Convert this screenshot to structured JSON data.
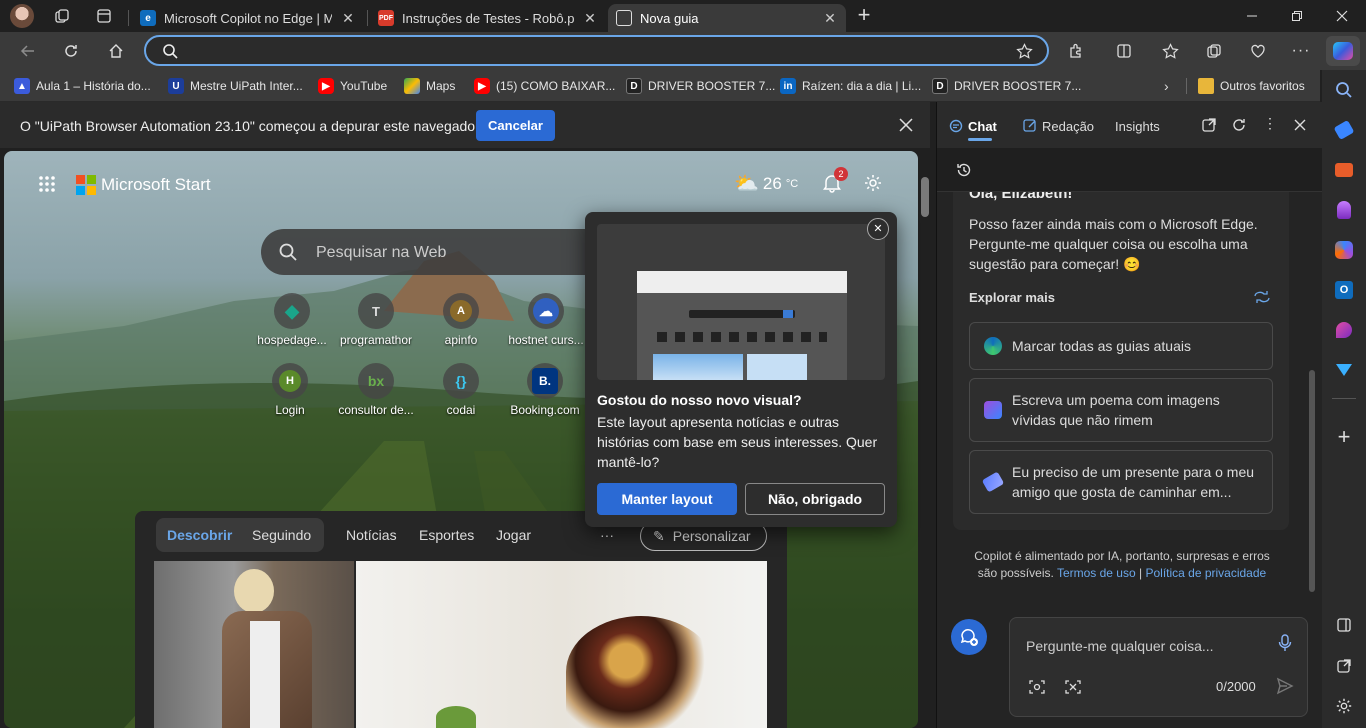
{
  "tabs": [
    {
      "title": "Microsoft Copilot no Edge | Micr",
      "close": "✕"
    },
    {
      "title": "Instruções de Testes - Robô.pdf",
      "close": "✕"
    },
    {
      "title": "Nova guia",
      "close": "✕"
    }
  ],
  "new_tab_symbol": "+",
  "address": {
    "value": "",
    "placeholder": ""
  },
  "bookmarks": [
    {
      "label": "Aula 1 – História do...",
      "icon": "course-icon",
      "color": "#3b5bdb"
    },
    {
      "label": "Mestre UiPath Inter...",
      "icon": "uipath-icon",
      "color": "#1c3d9a"
    },
    {
      "label": "YouTube",
      "icon": "youtube-icon",
      "color": "#ff0000"
    },
    {
      "label": "Maps",
      "icon": "maps-icon",
      "color": "#34a853"
    },
    {
      "label": "(15) COMO BAIXAR...",
      "icon": "youtube-icon",
      "color": "#ff0000"
    },
    {
      "label": "DRIVER BOOSTER 7...",
      "icon": "driver-booster-icon",
      "color": "#222222"
    },
    {
      "label": "Raízen: dia a dia | Li...",
      "icon": "linkedin-icon",
      "color": "#0a66c2"
    },
    {
      "label": "DRIVER BOOSTER 7...",
      "icon": "driver-booster-icon",
      "color": "#222222"
    }
  ],
  "other_favorites": "Outros favoritos",
  "infobar": {
    "message": "O \"UiPath Browser Automation 23.10\" começou a depurar este navegador",
    "cancel": "Cancelar"
  },
  "start": {
    "brand": "Microsoft Start",
    "temperature": "26",
    "temp_unit": "°C",
    "notif_count": "2",
    "search_placeholder": "Pesquisar na Web",
    "shortcuts": [
      {
        "label": "hospedage...",
        "glyph": "◆",
        "color": "#1aa58a"
      },
      {
        "label": "programathor",
        "glyph": "T",
        "color": "#555555"
      },
      {
        "label": "apinfo",
        "glyph": "A",
        "color": "#8a6a2a"
      },
      {
        "label": "hostnet curs...",
        "glyph": "☁",
        "color": "#3060c0"
      },
      {
        "label": "Login",
        "glyph": "H",
        "color": "#5a8a2a"
      },
      {
        "label": "consultor de...",
        "glyph": "bx",
        "color": "#3a6a3a"
      },
      {
        "label": "codai",
        "glyph": "{}",
        "color": "#3a3a3a"
      },
      {
        "label": "Booking.com",
        "glyph": "B.",
        "color": "#003580"
      }
    ],
    "feed_tabs": [
      "Descobrir",
      "Seguindo",
      "Notícias",
      "Esportes",
      "Jogar"
    ],
    "more": "···",
    "personalize": "Personalizar"
  },
  "popup": {
    "title": "Gostou do nosso novo visual?",
    "body": "Este layout apresenta notícias e outras histórias com base em seus interesses. Quer mantê-lo?",
    "primary": "Manter layout",
    "secondary": "Não, obrigado",
    "close": "✕"
  },
  "copilot": {
    "tabs": [
      "Chat",
      "Redação",
      "Insights"
    ],
    "greeting": "Olá, Elizabeth!",
    "intro": "Posso fazer ainda mais com o Microsoft Edge. Pergunte-me qualquer coisa ou escolha uma sugestão para começar! 😊",
    "explore": "Explorar mais",
    "suggestions": [
      {
        "text": "Marcar todas as guias atuais",
        "icon": "edge-icon"
      },
      {
        "text": "Escreva um poema com imagens vívidas que não rimem",
        "icon": "image-create-icon"
      },
      {
        "text": "Eu preciso de um presente para o meu amigo que gosta de caminhar em...",
        "icon": "tag-icon"
      }
    ],
    "disclaimer": "Copilot é alimentado por IA, portanto, surpresas e erros são possíveis.",
    "terms": "Termos de uso",
    "sep": "|",
    "privacy": "Política de privacidade",
    "input_placeholder": "Pergunte-me qualquer coisa...",
    "counter": "0/2000"
  },
  "colors": {
    "accent": "#2b6ad4",
    "address_border": "#6aa6e8",
    "copilot_blue": "#2b6ad4"
  }
}
